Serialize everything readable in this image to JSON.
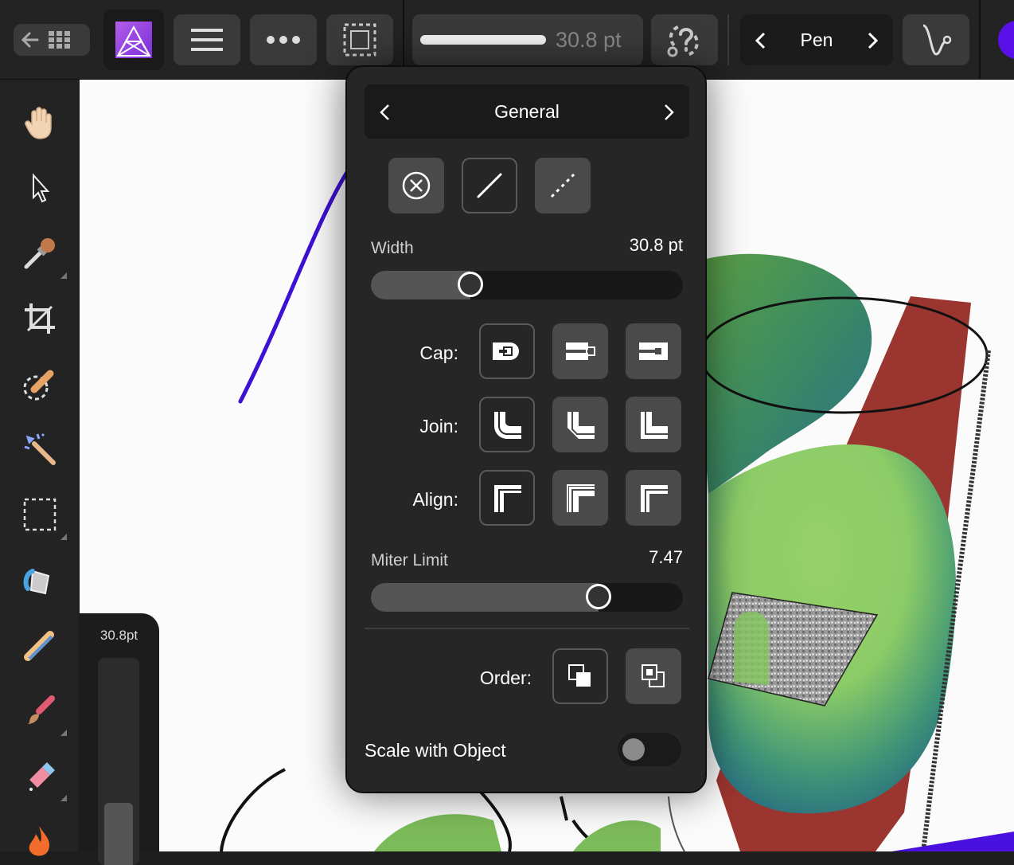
{
  "toolbar": {
    "back_icon": "back-arrow-grid-icon",
    "brush_width_value": "30.8 pt",
    "brush_name": "Pen",
    "accent_color": "#5a10e8"
  },
  "tools": [
    "hand-icon",
    "move-arrow-icon",
    "eyedropper-icon",
    "crop-icon",
    "selection-brush-icon",
    "magic-wand-icon",
    "marquee-icon",
    "flood-fill-icon",
    "pen-pencil-icon",
    "paint-brush-icon",
    "eraser-icon",
    "burn-icon"
  ],
  "size_panel": {
    "label": "30.8pt",
    "level_fraction": 0.3
  },
  "popup": {
    "title": "General",
    "width_label": "Width",
    "width_value": "30.8 pt",
    "width_fraction": 0.32,
    "cap_label": "Cap:",
    "join_label": "Join:",
    "align_label": "Align:",
    "miter_label": "Miter Limit",
    "miter_value": "7.47",
    "miter_fraction": 0.73,
    "order_label": "Order:",
    "scale_label": "Scale with Object",
    "scale_on": false
  }
}
